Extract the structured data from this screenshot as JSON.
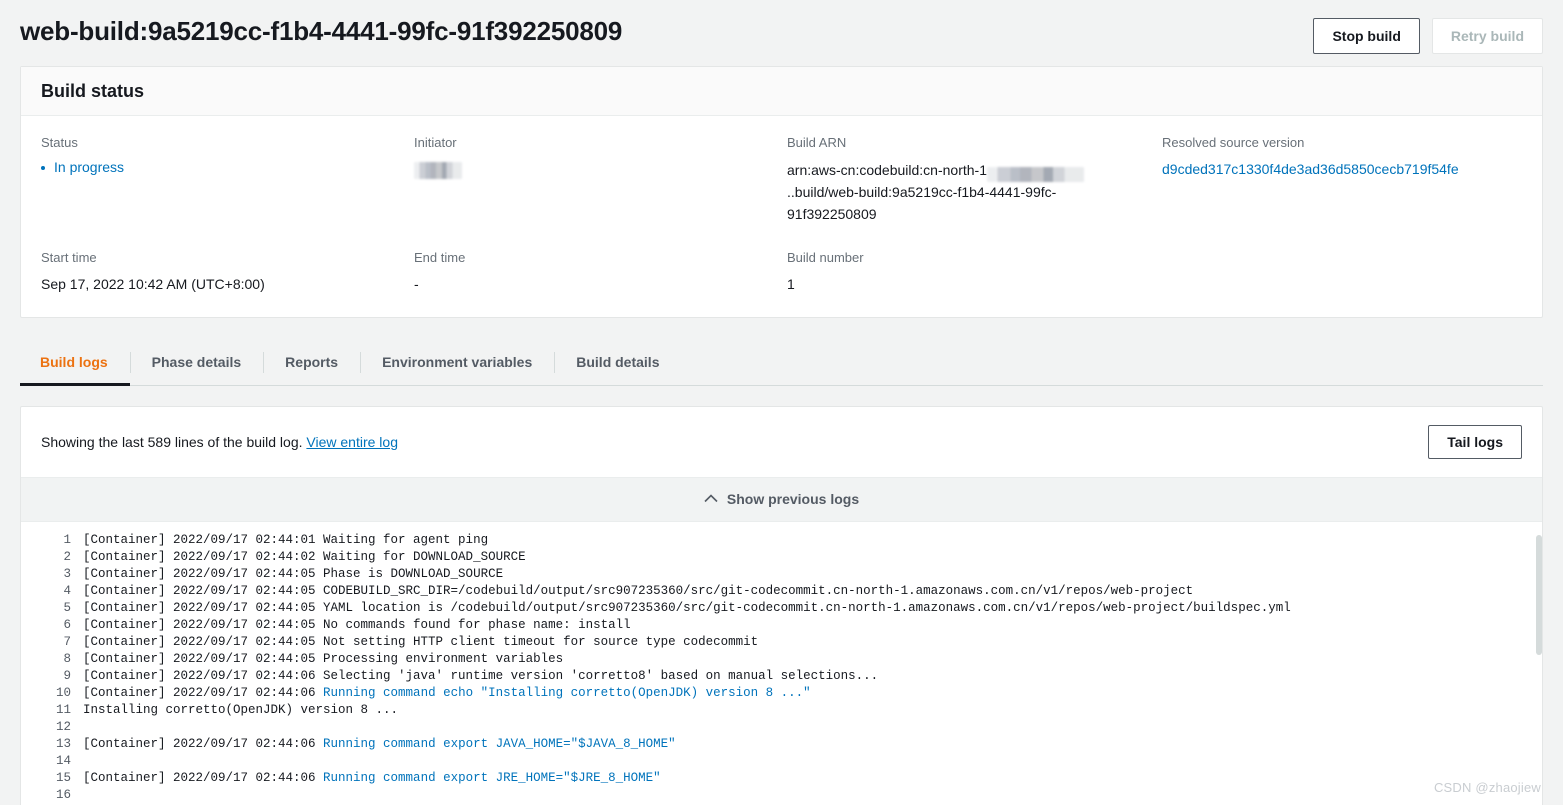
{
  "header": {
    "title": "web-build:9a5219cc-f1b4-4441-99fc-91f392250809",
    "stop_build_label": "Stop build",
    "retry_build_label": "Retry build"
  },
  "build_status": {
    "section_title": "Build status",
    "fields": {
      "status_label": "Status",
      "status_value": "In progress",
      "initiator_label": "Initiator",
      "initiator_value": "",
      "build_arn_label": "Build ARN",
      "build_arn_prefix": "arn:aws-cn:codebuild:cn-north-1",
      "build_arn_suffix": "..build/web-build:9a5219cc-f1b4-4441-99fc-91f392250809",
      "resolved_source_version_label": "Resolved source version",
      "resolved_source_version_value": "d9cded317c1330f4de3ad36d5850cecb719f54fe",
      "start_time_label": "Start time",
      "start_time_value": "Sep 17, 2022 10:42 AM (UTC+8:00)",
      "end_time_label": "End time",
      "end_time_value": "-",
      "build_number_label": "Build number",
      "build_number_value": "1"
    }
  },
  "tabs": [
    {
      "label": "Build logs",
      "active": true
    },
    {
      "label": "Phase details",
      "active": false
    },
    {
      "label": "Reports",
      "active": false
    },
    {
      "label": "Environment variables",
      "active": false
    },
    {
      "label": "Build details",
      "active": false
    }
  ],
  "logs_panel": {
    "showing_text": "Showing the last 589 lines of the build log.",
    "view_entire_log_label": "View entire log",
    "tail_logs_label": "Tail logs",
    "show_previous_logs_label": "Show previous logs",
    "lines": [
      {
        "n": "1",
        "text": "[Container] 2022/09/17 02:44:01 Waiting for agent ping",
        "cmd": ""
      },
      {
        "n": "2",
        "text": "[Container] 2022/09/17 02:44:02 Waiting for DOWNLOAD_SOURCE",
        "cmd": ""
      },
      {
        "n": "3",
        "text": "[Container] 2022/09/17 02:44:05 Phase is DOWNLOAD_SOURCE",
        "cmd": ""
      },
      {
        "n": "4",
        "text": "[Container] 2022/09/17 02:44:05 CODEBUILD_SRC_DIR=/codebuild/output/src907235360/src/git-codecommit.cn-north-1.amazonaws.com.cn/v1/repos/web-project",
        "cmd": ""
      },
      {
        "n": "5",
        "text": "[Container] 2022/09/17 02:44:05 YAML location is /codebuild/output/src907235360/src/git-codecommit.cn-north-1.amazonaws.com.cn/v1/repos/web-project/buildspec.yml",
        "cmd": ""
      },
      {
        "n": "6",
        "text": "[Container] 2022/09/17 02:44:05 No commands found for phase name: install",
        "cmd": ""
      },
      {
        "n": "7",
        "text": "[Container] 2022/09/17 02:44:05 Not setting HTTP client timeout for source type codecommit",
        "cmd": ""
      },
      {
        "n": "8",
        "text": "[Container] 2022/09/17 02:44:05 Processing environment variables",
        "cmd": ""
      },
      {
        "n": "9",
        "text": "[Container] 2022/09/17 02:44:06 Selecting 'java' runtime version 'corretto8' based on manual selections...",
        "cmd": ""
      },
      {
        "n": "10",
        "text": "[Container] 2022/09/17 02:44:06 ",
        "cmd": "Running command echo \"Installing corretto(OpenJDK) version 8 ...\""
      },
      {
        "n": "11",
        "text": "Installing corretto(OpenJDK) version 8 ...",
        "cmd": ""
      },
      {
        "n": "12",
        "text": "",
        "cmd": ""
      },
      {
        "n": "13",
        "text": "[Container] 2022/09/17 02:44:06 ",
        "cmd": "Running command export JAVA_HOME=\"$JAVA_8_HOME\""
      },
      {
        "n": "14",
        "text": "",
        "cmd": ""
      },
      {
        "n": "15",
        "text": "[Container] 2022/09/17 02:44:06 ",
        "cmd": "Running command export JRE_HOME=\"$JRE_8_HOME\""
      },
      {
        "n": "16",
        "text": "",
        "cmd": ""
      }
    ]
  },
  "watermark": "CSDN @zhaojiew"
}
